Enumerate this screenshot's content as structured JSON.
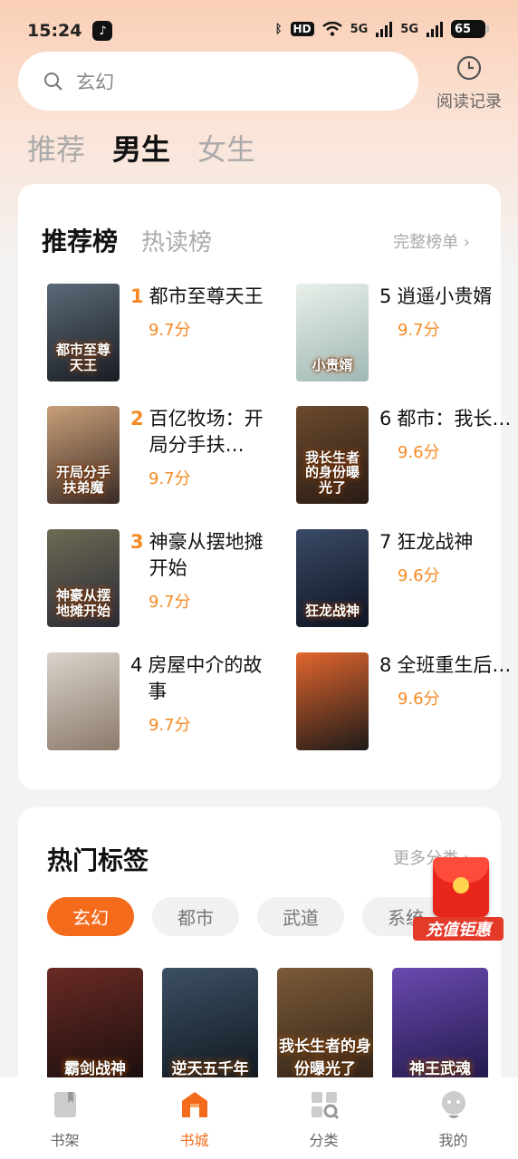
{
  "status": {
    "time": "15:24",
    "hd": "HD",
    "net1": "5G",
    "net2": "5G",
    "battery": "65"
  },
  "search": {
    "placeholder": "玄幻"
  },
  "history": {
    "label": "阅读记录"
  },
  "gender_tabs": [
    {
      "label": "推荐",
      "active": false
    },
    {
      "label": "男生",
      "active": true
    },
    {
      "label": "女生",
      "active": false
    }
  ],
  "rank_card": {
    "tabs": [
      {
        "label": "推荐榜",
        "active": true
      },
      {
        "label": "热读榜",
        "active": false
      }
    ],
    "more": "完整榜单 ›",
    "books": [
      {
        "rank": "1",
        "title": "都市至尊天王",
        "score": "9.7分",
        "cover_text": "都市至尊天王",
        "color_a": "#5b6a78",
        "color_b": "#1a1d22"
      },
      {
        "rank": "2",
        "title": "百亿牧场：开局分手扶…",
        "score": "9.7分",
        "cover_text": "开局分手扶弟魔",
        "color_a": "#c9a07a",
        "color_b": "#3a2a24"
      },
      {
        "rank": "3",
        "title": "神豪从摆地摊开始",
        "score": "9.7分",
        "cover_text": "神豪从摆地摊开始",
        "color_a": "#6d6a54",
        "color_b": "#2b2a35"
      },
      {
        "rank": "4",
        "title": "房屋中介的故事",
        "score": "9.7分",
        "cover_text": "",
        "color_a": "#d9d4cc",
        "color_b": "#8c7a6a"
      },
      {
        "rank": "5",
        "title": "逍遥小贵婿",
        "score": "9.7分",
        "cover_text": "小贵婿",
        "color_a": "#e9efe9",
        "color_b": "#9fb8b4"
      },
      {
        "rank": "6",
        "title": "都市：我长生者的身份",
        "score": "9.6分",
        "cover_text": "我长生者的身份曝光了",
        "color_a": "#6b4a2e",
        "color_b": "#2a1c14"
      },
      {
        "rank": "7",
        "title": "狂龙战神",
        "score": "9.6分",
        "cover_text": "狂龙战神",
        "color_a": "#3a4a66",
        "color_b": "#0e1422"
      },
      {
        "rank": "8",
        "title": "全班重生后，助我上",
        "score": "9.6分",
        "cover_text": "",
        "color_a": "#e2662e",
        "color_b": "#1d1a18"
      }
    ]
  },
  "tags_card": {
    "title": "热门标签",
    "more": "更多分类 ›",
    "chips": [
      {
        "label": "玄幻",
        "active": true
      },
      {
        "label": "都市",
        "active": false
      },
      {
        "label": "武道",
        "active": false
      },
      {
        "label": "系统",
        "active": false
      }
    ],
    "minis": [
      {
        "text": "霸剑战神",
        "color_a": "#6a2a24",
        "color_b": "#120c0c"
      },
      {
        "text": "逆天五千年",
        "color_a": "#3c5064",
        "color_b": "#0c1218"
      },
      {
        "text": "我长生者的身份曝光了",
        "color_a": "#7a5a38",
        "color_b": "#2a1d14"
      },
      {
        "text": "神王武魂",
        "color_a": "#6a4ab0",
        "color_b": "#1a1440"
      }
    ]
  },
  "redpacket": {
    "label": "充值钜惠"
  },
  "nav": [
    {
      "label": "书架",
      "icon": "bookshelf-icon",
      "active": false
    },
    {
      "label": "书城",
      "icon": "bookstore-icon",
      "active": true
    },
    {
      "label": "分类",
      "icon": "category-icon",
      "active": false
    },
    {
      "label": "我的",
      "icon": "profile-icon",
      "active": false
    }
  ],
  "accent": "#f46b1c",
  "score_color": "#f58a24"
}
